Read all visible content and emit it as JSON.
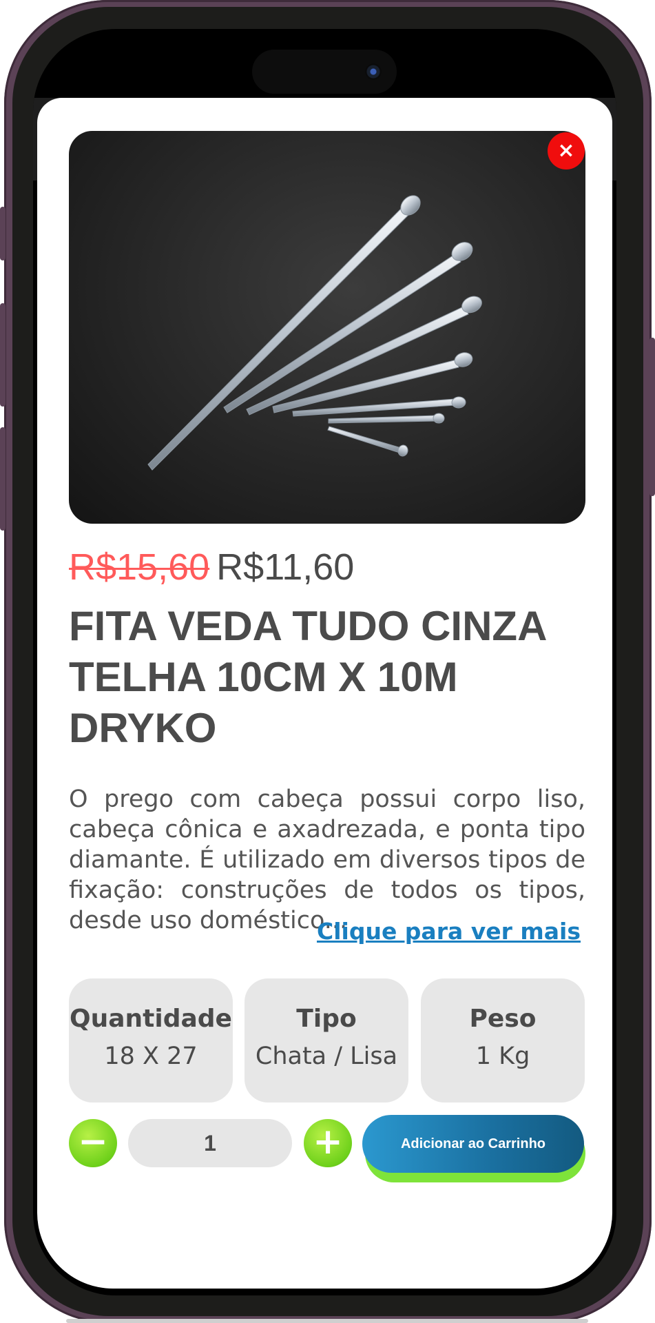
{
  "product": {
    "old_price": "R$15,60",
    "new_price": "R$11,60",
    "title": "FITA VEDA TUDO CINZA TELHA 10CM X 10M DRYKO",
    "description": "O prego com cabeça possui corpo liso, cabeça cônica e axadrezada, e ponta tipo diamante. É utilizado em diversos tipos de fixação: construções de todos os tipos, desde uso doméstico...",
    "more_link": "Clique para ver mais",
    "close_label": "×"
  },
  "specs": [
    {
      "label": "Quantidade",
      "value": "18 X 27"
    },
    {
      "label": "Tipo",
      "value": "Chata / Lisa"
    },
    {
      "label": "Peso",
      "value": "1 Kg"
    }
  ],
  "cart": {
    "decrement_label": "−",
    "quantity": "1",
    "increment_label": "+",
    "add_label": "Adicionar ao Carrinho"
  },
  "colors": {
    "accent_green": "#6fd11b",
    "cart_blue": "#1a6f9f",
    "old_price_red": "#ff5a5a",
    "close_red": "#f00d0d",
    "link_blue": "#1a7fc0"
  },
  "icons": {
    "close": "close-icon",
    "minus": "minus-icon",
    "plus": "plus-icon",
    "camera": "front-camera-icon"
  }
}
